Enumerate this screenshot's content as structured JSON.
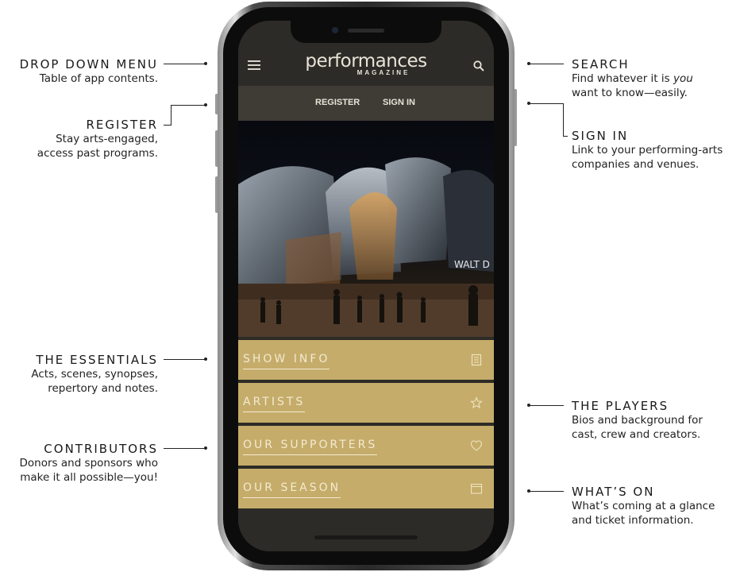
{
  "annotations": {
    "dropdown": {
      "title": "DROP DOWN MENU",
      "desc": [
        "Table of app contents."
      ]
    },
    "register": {
      "title": "REGISTER",
      "desc": [
        "Stay arts-engaged,",
        "access past programs."
      ]
    },
    "essentials": {
      "title": "THE ESSENTIALS",
      "desc": [
        "Acts, scenes, synopses,",
        "repertory and notes."
      ]
    },
    "contributors": {
      "title": "CONTRIBUTORS",
      "desc": [
        "Donors and sponsors who",
        "make it all possible—you!"
      ]
    },
    "search": {
      "title": "SEARCH",
      "desc_a": "Find whatever it is ",
      "desc_em": "you",
      "desc_b": "want to know—easily."
    },
    "signin": {
      "title": "SIGN IN",
      "desc": [
        "Link to your performing-arts",
        "companies and venues."
      ]
    },
    "players": {
      "title": "THE PLAYERS",
      "desc": [
        "Bios and background for",
        "cast, crew and creators."
      ]
    },
    "whatson": {
      "title": "WHAT’S ON",
      "desc": [
        "What’s coming at a glance",
        "and ticket information."
      ]
    }
  },
  "app": {
    "logo_word": "performances",
    "logo_sub": "MAGAZINE",
    "register_label": "REGISTER",
    "signin_label": "SIGN IN",
    "hero_sign_text": "WALT D",
    "menu_items": [
      {
        "label": "SHOW INFO",
        "icon": "document-icon"
      },
      {
        "label": "ARTISTS",
        "icon": "star-icon"
      },
      {
        "label": "OUR SUPPORTERS",
        "icon": "heart-icon"
      },
      {
        "label": "OUR SEASON",
        "icon": "calendar-icon"
      }
    ]
  },
  "colors": {
    "gold": "#c5ac6a",
    "dark": "#2d2b27",
    "subbar": "#3f3b35"
  }
}
